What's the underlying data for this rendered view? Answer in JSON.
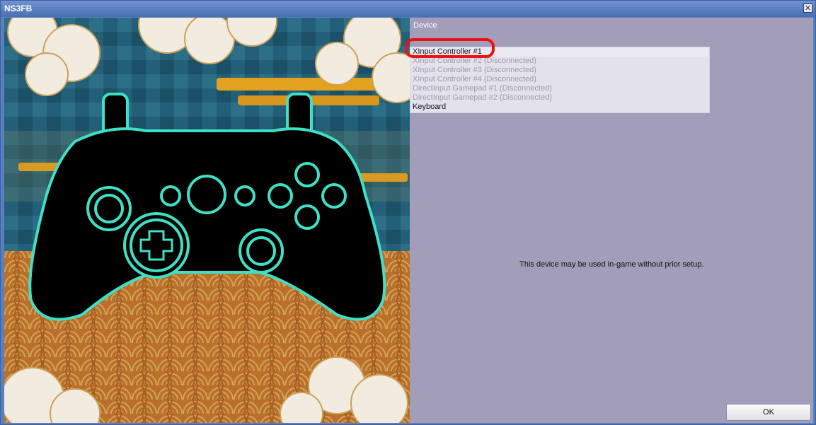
{
  "window": {
    "title": "NS3FB",
    "close_icon": "close-icon"
  },
  "art": {
    "subject": "gamepad-illustration",
    "colors": {
      "outline": "#3ee0c6",
      "controller": "#000000",
      "sky": "#1f5a73",
      "ground": "#c07a2a"
    }
  },
  "device_panel": {
    "label": "Device",
    "devices": [
      {
        "name": "XInput Controller #1"
      },
      {
        "name": "XInput Controller #2 (Disconnected)"
      },
      {
        "name": "XInput Controller #3 (Disconnected)"
      },
      {
        "name": "XInput Controller #4 (Disconnected)"
      },
      {
        "name": "DirectInput Gamepad #1 (Disconnected)"
      },
      {
        "name": "DirectInput Gamepad #2 (Disconnected)"
      },
      {
        "name": "Keyboard"
      }
    ],
    "selected_index": 0,
    "info_text": "This device may be used in-game without prior setup."
  },
  "buttons": {
    "ok_label": "OK"
  },
  "colors": {
    "highlight": "#ee1111",
    "panel_bg": "#a29db9",
    "titlebar": "#5a7fbf"
  }
}
